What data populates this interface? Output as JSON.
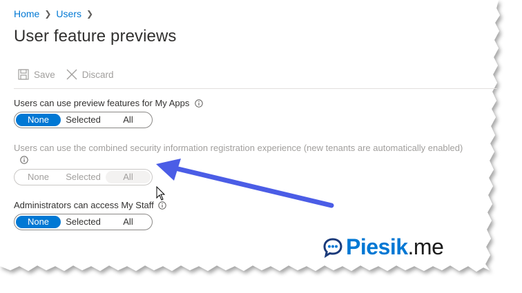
{
  "breadcrumb": [
    "Home",
    "Users"
  ],
  "page_title": "User feature previews",
  "toolbar": {
    "save_label": "Save",
    "discard_label": "Discard",
    "save_icon": "save-icon",
    "discard_icon": "close-icon"
  },
  "settings": [
    {
      "label": "Users can use preview features for My Apps",
      "options": [
        "None",
        "Selected",
        "All"
      ],
      "selected": "None",
      "disabled": false
    },
    {
      "label": "Users can use the combined security information registration experience (new tenants are automatically enabled)",
      "options": [
        "None",
        "Selected",
        "All"
      ],
      "selected": "All",
      "disabled": true
    },
    {
      "label": "Administrators can access My Staff",
      "options": [
        "None",
        "Selected",
        "All"
      ],
      "selected": "None",
      "disabled": false
    }
  ],
  "watermark": {
    "name": "Piesik",
    "tld": ".me",
    "icon": "chat-bubble-icon"
  },
  "colors": {
    "accent": "#0078d4",
    "disabled_text": "#a19f9d",
    "arrow": "#4b5de6",
    "text": "#323130"
  }
}
